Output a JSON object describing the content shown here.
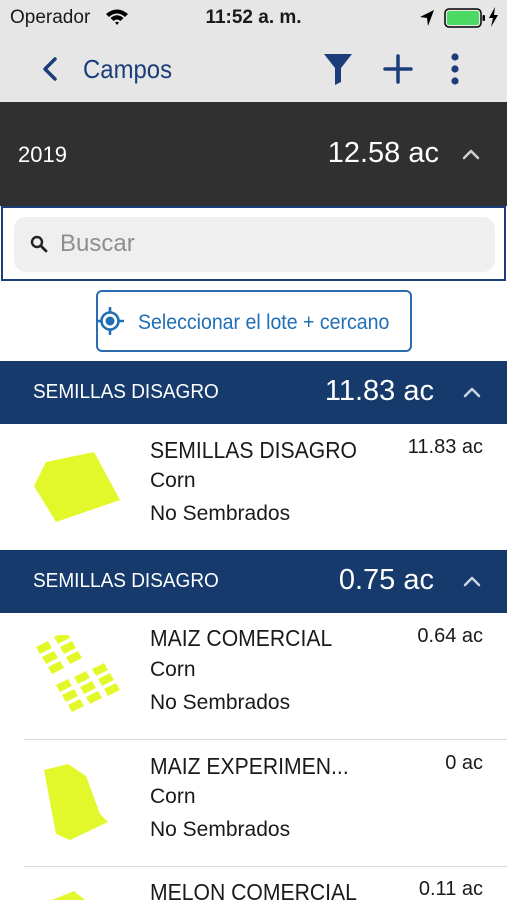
{
  "status_bar": {
    "carrier": "Operador",
    "time": "11:52 a. m."
  },
  "nav": {
    "title": "Campos",
    "icons": [
      "back-chevron-icon",
      "filter-icon",
      "plus-icon",
      "more-vertical-icon"
    ]
  },
  "season": {
    "year": "2019",
    "total": "12.58 ac"
  },
  "search": {
    "placeholder": "Buscar"
  },
  "nearest_button": {
    "label": "Seleccionar el lote + cercano"
  },
  "groups": [
    {
      "name": "SEMILLAS DISAGRO",
      "total": "11.83 ac",
      "fields": [
        {
          "name": "SEMILLAS DISAGRO",
          "crop": "Corn",
          "status": "No Sembrados",
          "area": "11.83 ac"
        }
      ]
    },
    {
      "name": "SEMILLAS DISAGRO",
      "total": "0.75 ac",
      "fields": [
        {
          "name": "MAIZ COMERCIAL",
          "crop": "Corn",
          "status": "No Sembrados",
          "area": "0.64 ac"
        },
        {
          "name": "MAIZ EXPERIMEN...",
          "crop": "Corn",
          "status": "No Sembrados",
          "area": "0 ac"
        },
        {
          "name": "MELON COMERCIAL",
          "crop": "",
          "status": "",
          "area": "0.11 ac"
        }
      ]
    }
  ],
  "colors": {
    "nav_accent": "#1b3d7a",
    "group_header": "#163a6b",
    "year_bar": "#303030",
    "field_shape": "#e3f82a",
    "battery": "#4cd964"
  }
}
